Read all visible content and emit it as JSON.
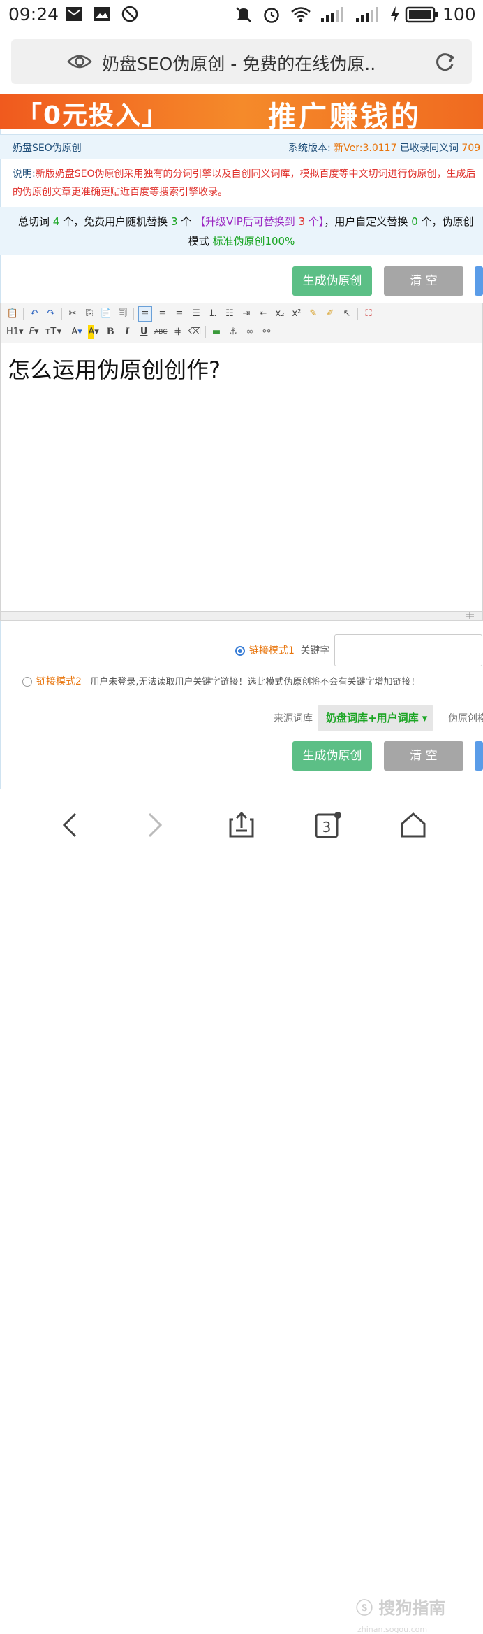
{
  "status_bar": {
    "time": "09:24",
    "battery": "100",
    "icons": [
      "mail-icon",
      "image-icon",
      "block-icon",
      "mute-icon",
      "alarm-icon",
      "wifi-icon",
      "signal-icon",
      "signal-icon",
      "charging-icon",
      "battery-icon"
    ]
  },
  "url_bar": {
    "title": "奶盘SEO伪原创 - 免费的在线伪原..",
    "icons": [
      "eye-icon",
      "reload-icon"
    ]
  },
  "banner": {
    "left_text": "「0元投入」",
    "right_text": "推广赚钱的"
  },
  "tool_header": {
    "name": "奶盘SEO伪原创",
    "version_label": "系统版本:",
    "version_value": "新Ver:3.0117",
    "synonym_label": "已收录同义词",
    "synonym_value": "709"
  },
  "description": {
    "label": "说明:",
    "text": "新版奶盘SEO伪原创采用独有的分词引擎以及自创同义词库，模拟百度等中文切词进行伪原创，生成后的伪原创文章更准确更贴近百度等搜索引擎收录。"
  },
  "stats": {
    "total_label": "总切词",
    "total_value": "4",
    "unit": "个",
    "free_label": "，免费用户随机替换",
    "free_value": "3",
    "vip_prefix": "【升级VIP后可替换到",
    "vip_value": "3",
    "vip_suffix": "个】",
    "custom_label": "，用户自定义替换",
    "custom_value": "0",
    "tail": "个，伪原创",
    "mode_label": "模式",
    "mode_value": "标准伪原创100%"
  },
  "buttons": {
    "generate": "生成伪原创",
    "clear": "清 空"
  },
  "toolbar": {
    "row1": [
      "paste-icon",
      "undo-icon",
      "redo-icon",
      "cut-icon",
      "copy-icon",
      "paste-text-icon",
      "paste-word-icon",
      "align-left-icon",
      "align-center-icon",
      "align-right-icon",
      "align-justify-icon",
      "ordered-list-icon",
      "unordered-list-icon",
      "indent-icon",
      "outdent-icon",
      "subscript-icon",
      "superscript-icon",
      "clear-format-icon",
      "source-icon",
      "select-icon",
      "fullscreen-icon"
    ],
    "row2_labels": {
      "heading": "H1",
      "font": "F",
      "size": "тT",
      "color": "A",
      "bg": "A",
      "bold": "B",
      "italic": "I",
      "underline": "U",
      "strike": "ABC"
    }
  },
  "editor": {
    "content": "怎么运用伪原创创作?"
  },
  "options": {
    "mode1_label": "链接模式1",
    "keyword_label": "关键字",
    "mode2_label": "链接模式2",
    "mode2_note": "用户未登录,无法读取用户关键字链接！选此模式伪原创将不会有关键字增加链接！",
    "source_label": "来源词库",
    "source_value": "奶盘词库+用户词库 ▾",
    "pseudo_label": "伪原创模"
  },
  "bottom_nav": {
    "tabs_count": "3",
    "icons": [
      "back-icon",
      "forward-icon",
      "share-icon",
      "tabs-icon",
      "home-icon"
    ]
  },
  "watermark": {
    "text": "搜狗指南",
    "sub": "zhinan.sogou.com"
  }
}
